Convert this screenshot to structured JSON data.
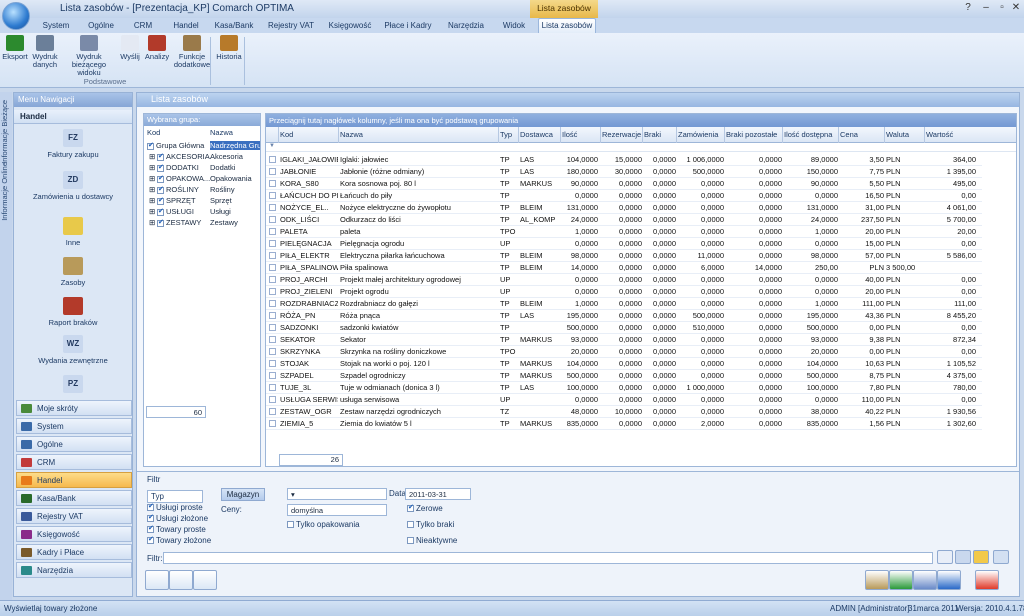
{
  "window": {
    "title": "Lista zasobów - [Prezentacja_KP] Comarch OPTIMA",
    "context_tab": "Lista zasobów"
  },
  "menu": [
    "System",
    "Ogólne",
    "CRM",
    "Handel",
    "Kasa/Bank",
    "Rejestry VAT",
    "Księgowość",
    "Płace i Kadry",
    "Narzędzia",
    "Widok",
    "Lista zasobów"
  ],
  "ribbon": {
    "buttons": [
      "Eksport",
      "Wydruk danych",
      "Wydruk bieżącego widoku",
      "Wyślij",
      "Analizy",
      "Funkcje dodatkowe",
      "Historia"
    ],
    "group": "Podstawowe"
  },
  "side_tabs": [
    "Informacje Bieżące",
    "Informacje Online"
  ],
  "nav": {
    "header": "Menu Nawigacji",
    "section": "Handel",
    "items": [
      {
        "label": "Faktury zakupu",
        "icon": "FZ"
      },
      {
        "label": "Zamówienia u dostawcy",
        "icon": "ZD"
      },
      {
        "label": "Inne",
        "icon": ""
      },
      {
        "label": "Zasoby",
        "icon": ""
      },
      {
        "label": "Raport braków",
        "icon": ""
      },
      {
        "label": "Wydania zewnętrzne",
        "icon": "WZ"
      },
      {
        "label": "",
        "icon": "PZ"
      }
    ],
    "modules": [
      "Moje skróty",
      "System",
      "Ogólne",
      "CRM",
      "Handel",
      "Kasa/Bank",
      "Rejestry VAT",
      "Księgowość",
      "Kadry i Płace",
      "Narzędzia"
    ]
  },
  "panel": {
    "title": "Lista zasobów"
  },
  "groups": {
    "header": "Wybrana grupa:",
    "cols": [
      "Kod",
      "Nazwa"
    ],
    "rows": [
      [
        "Grupa Główna",
        "Nadrzędna Grupa"
      ],
      [
        "AKCESORIA",
        "Akcesoria"
      ],
      [
        "DODATKI",
        "Dodatki"
      ],
      [
        "OPAKOWA...",
        "Opakowania"
      ],
      [
        "ROŚLINY",
        "Rośliny"
      ],
      [
        "SPRZĘT",
        "Sprzęt"
      ],
      [
        "USŁUGI",
        "Usługi"
      ],
      [
        "ZESTAWY",
        "Zestawy"
      ]
    ],
    "count": "60"
  },
  "grid": {
    "drag_hint": "Przeciągnij tutaj nagłówek kolumny, jeśli ma ona być podstawą grupowania",
    "columns": [
      "Kod",
      "Nazwa",
      "Typ",
      "Dostawca",
      "Ilość",
      "Rezerwacje",
      "Braki",
      "Zamówienia",
      "Braki pozostałe",
      "Ilość dostępna",
      "Cena",
      "Waluta",
      "Wartość"
    ],
    "count": "26",
    "rows": [
      [
        "IGLAKI_JAŁOWIEC",
        "Iglaki: jałowiec",
        "TP",
        "LAS",
        "104,0000",
        "15,0000",
        "0,0000",
        "1 006,0000",
        "0,0000",
        "89,0000",
        "3,50",
        "PLN",
        "364,00"
      ],
      [
        "JABŁONIE",
        "Jabłonie (różne odmiany)",
        "TP",
        "LAS",
        "180,0000",
        "30,0000",
        "0,0000",
        "500,0000",
        "0,0000",
        "150,0000",
        "7,75",
        "PLN",
        "1 395,00"
      ],
      [
        "KORA_S80",
        "Kora sosnowa poj. 80 l",
        "TP",
        "MARKUS",
        "90,0000",
        "0,0000",
        "0,0000",
        "0,0000",
        "0,0000",
        "90,0000",
        "5,50",
        "PLN",
        "495,00"
      ],
      [
        "ŁAŃCUCH DO PIŁY",
        "Łańcuch do piły",
        "TP",
        "",
        "0,0000",
        "0,0000",
        "0,0000",
        "0,0000",
        "0,0000",
        "0,0000",
        "16,50",
        "PLN",
        "0,00"
      ],
      [
        "NOŻYCE_EL..",
        "Nożyce elektryczne do żywopłotu",
        "TP",
        "BLEIM",
        "131,0000",
        "0,0000",
        "0,0000",
        "0,0000",
        "0,0000",
        "131,0000",
        "31,00",
        "PLN",
        "4 061,00"
      ],
      [
        "ODK_LIŚCI",
        "Odkurzacz do liści",
        "TP",
        "AL_KOMP",
        "24,0000",
        "0,0000",
        "0,0000",
        "0,0000",
        "0,0000",
        "24,0000",
        "237,50",
        "PLN",
        "5 700,00"
      ],
      [
        "PALETA",
        "paleta",
        "TPO",
        "",
        "1,0000",
        "0,0000",
        "0,0000",
        "0,0000",
        "0,0000",
        "1,0000",
        "20,00",
        "PLN",
        "20,00"
      ],
      [
        "PIELĘGNACJA",
        "Pielęgnacja ogrodu",
        "UP",
        "",
        "0,0000",
        "0,0000",
        "0,0000",
        "0,0000",
        "0,0000",
        "0,0000",
        "15,00",
        "PLN",
        "0,00"
      ],
      [
        "PIŁA_ELEKTR",
        "Elektryczna piłarka łańcuchowa",
        "TP",
        "BLEIM",
        "98,0000",
        "0,0000",
        "0,0000",
        "11,0000",
        "0,0000",
        "98,0000",
        "57,00",
        "PLN",
        "5 586,00"
      ],
      [
        "PIŁA_SPALINOWA",
        "Piła spalinowa",
        "TP",
        "BLEIM",
        "14,0000",
        "0,0000",
        "0,0000",
        "6,0000",
        "14,0000",
        "250,00",
        "PLN",
        "3 500,00",
        ""
      ],
      [
        "PROJ_ARCHI",
        "Projekt małej architektury ogrodowej",
        "UP",
        "",
        "0,0000",
        "0,0000",
        "0,0000",
        "0,0000",
        "0,0000",
        "0,0000",
        "40,00",
        "PLN",
        "0,00"
      ],
      [
        "PROJ_ZIELENI",
        "Projekt ogrodu",
        "UP",
        "",
        "0,0000",
        "0,0000",
        "0,0000",
        "0,0000",
        "0,0000",
        "0,0000",
        "20,00",
        "PLN",
        "0,00"
      ],
      [
        "ROZDRABNIACZ",
        "Rozdrabniacz do gałęzi",
        "TP",
        "BLEIM",
        "1,0000",
        "0,0000",
        "0,0000",
        "0,0000",
        "0,0000",
        "1,0000",
        "111,00",
        "PLN",
        "111,00"
      ],
      [
        "RÓŻA_PN",
        "Róża pnąca",
        "TP",
        "LAS",
        "195,0000",
        "0,0000",
        "0,0000",
        "500,0000",
        "0,0000",
        "195,0000",
        "43,36",
        "PLN",
        "8 455,20"
      ],
      [
        "SADZONKI",
        "sadzonki kwiatów",
        "TP",
        "",
        "500,0000",
        "0,0000",
        "0,0000",
        "510,0000",
        "0,0000",
        "500,0000",
        "0,00",
        "PLN",
        "0,00"
      ],
      [
        "SEKATOR",
        "Sekator",
        "TP",
        "MARKUS",
        "93,0000",
        "0,0000",
        "0,0000",
        "0,0000",
        "0,0000",
        "93,0000",
        "9,38",
        "PLN",
        "872,34"
      ],
      [
        "SKRZYNKA",
        "Skrzynka na rośliny doniczkowe",
        "TPO",
        "",
        "20,0000",
        "0,0000",
        "0,0000",
        "0,0000",
        "0,0000",
        "20,0000",
        "0,00",
        "PLN",
        "0,00"
      ],
      [
        "STOJAK",
        "Stojak na worki o poj. 120 l",
        "TP",
        "MARKUS",
        "104,0000",
        "0,0000",
        "0,0000",
        "0,0000",
        "0,0000",
        "104,0000",
        "10,63",
        "PLN",
        "1 105,52"
      ],
      [
        "SZPADEL",
        "Szpadel ogrodniczy",
        "TP",
        "MARKUS",
        "500,0000",
        "0,0000",
        "0,0000",
        "0,0000",
        "0,0000",
        "500,0000",
        "8,75",
        "PLN",
        "4 375,00"
      ],
      [
        "TUJE_3L",
        "Tuje w odmianach (donica 3 l)",
        "TP",
        "LAS",
        "100,0000",
        "0,0000",
        "0,0000",
        "1 000,0000",
        "0,0000",
        "100,0000",
        "7,80",
        "PLN",
        "780,00"
      ],
      [
        "USŁUGA SERWIS...",
        "usługa serwisowa",
        "UP",
        "",
        "0,0000",
        "0,0000",
        "0,0000",
        "0,0000",
        "0,0000",
        "0,0000",
        "110,00",
        "PLN",
        "0,00"
      ],
      [
        "ZESTAW_OGR",
        "Zestaw narzędzi ogrodniczych",
        "TZ",
        "",
        "48,0000",
        "10,0000",
        "0,0000",
        "0,0000",
        "0,0000",
        "38,0000",
        "40,22",
        "PLN",
        "1 930,56"
      ],
      [
        "ZIEMIA_5",
        "Ziemia do kwiatów 5 l",
        "TP",
        "MARKUS",
        "835,0000",
        "0,0000",
        "0,0000",
        "2,0000",
        "0,0000",
        "835,0000",
        "1,56",
        "PLN",
        "1 302,60"
      ]
    ]
  },
  "filter": {
    "title": "Filtr",
    "typ": "Typ",
    "types": [
      {
        "label": "Usługi proste",
        "on": true
      },
      {
        "label": "Usługi złożone",
        "on": true
      },
      {
        "label": "Towary proste",
        "on": true
      },
      {
        "label": "Towary złożone",
        "on": true
      }
    ],
    "magazyn_btn": "Magazyn",
    "data_label": "Data:",
    "data_value": "2011-03-31",
    "ceny_label": "Ceny:",
    "ceny_value": "domyślna",
    "tylko_opak": "Tylko opakowania",
    "zerowe": "Zerowe",
    "tylko_braki": "Tylko braki",
    "niealtywne": "Nieaktywne",
    "filtr_label": "Filtr:"
  },
  "status": {
    "left": "Wyświetlaj towary złożone",
    "user": "ADMIN [Administrator]",
    "date": "31marca 2011",
    "version": "Wersja: 2010.4.1.785"
  }
}
